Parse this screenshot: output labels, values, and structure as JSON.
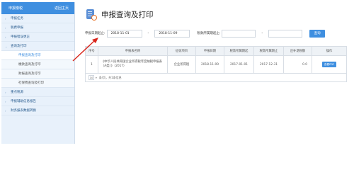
{
  "sidebar": {
    "brand": "申报缴税",
    "back_label": "返回主页",
    "items": [
      {
        "label": "申报任务",
        "type": "section"
      },
      {
        "label": "税费申报",
        "type": "section"
      },
      {
        "label": "申报错误更正",
        "type": "section"
      },
      {
        "label": "查询及打印",
        "type": "section"
      },
      {
        "label": "申报查询及打印",
        "type": "sub",
        "active": true
      },
      {
        "label": "缴款查询及打印",
        "type": "sub"
      },
      {
        "label": "财报查询及打印",
        "type": "sub"
      },
      {
        "label": "社保费查询及打印",
        "type": "sub"
      },
      {
        "label": "重点税源",
        "type": "section"
      },
      {
        "label": "申报辅助信息报告",
        "type": "section"
      },
      {
        "label": "财务报表数据转换",
        "type": "section"
      }
    ]
  },
  "main": {
    "title": "申报查询及打印",
    "filters": {
      "date_label": "申报日期起止:",
      "date_from": "2018-11-01",
      "date_to": "2018-11-09",
      "period_label": "税款所属期起止:",
      "period_from": "",
      "period_to": "",
      "separator": "-",
      "query_button": "查询"
    },
    "table": {
      "columns": [
        "序号",
        "申报表名称",
        "征收项目",
        "申报日期",
        "税款所属期起",
        "税款所属期止",
        "应补退税额",
        "操作"
      ],
      "rows": [
        {
          "index": "1",
          "name": "《中华人民共和国企业所得税年度纳税申报表（A类）》（2017）",
          "item": "企业所得税",
          "date": "2018-11-09",
          "period_start": "2017-01-01",
          "period_end": "2017-12-31",
          "amount": "0.0",
          "action": "查看PDF"
        }
      ],
      "footer": {
        "page_size": "10",
        "summary": "条/页，共1条信息"
      }
    }
  }
}
